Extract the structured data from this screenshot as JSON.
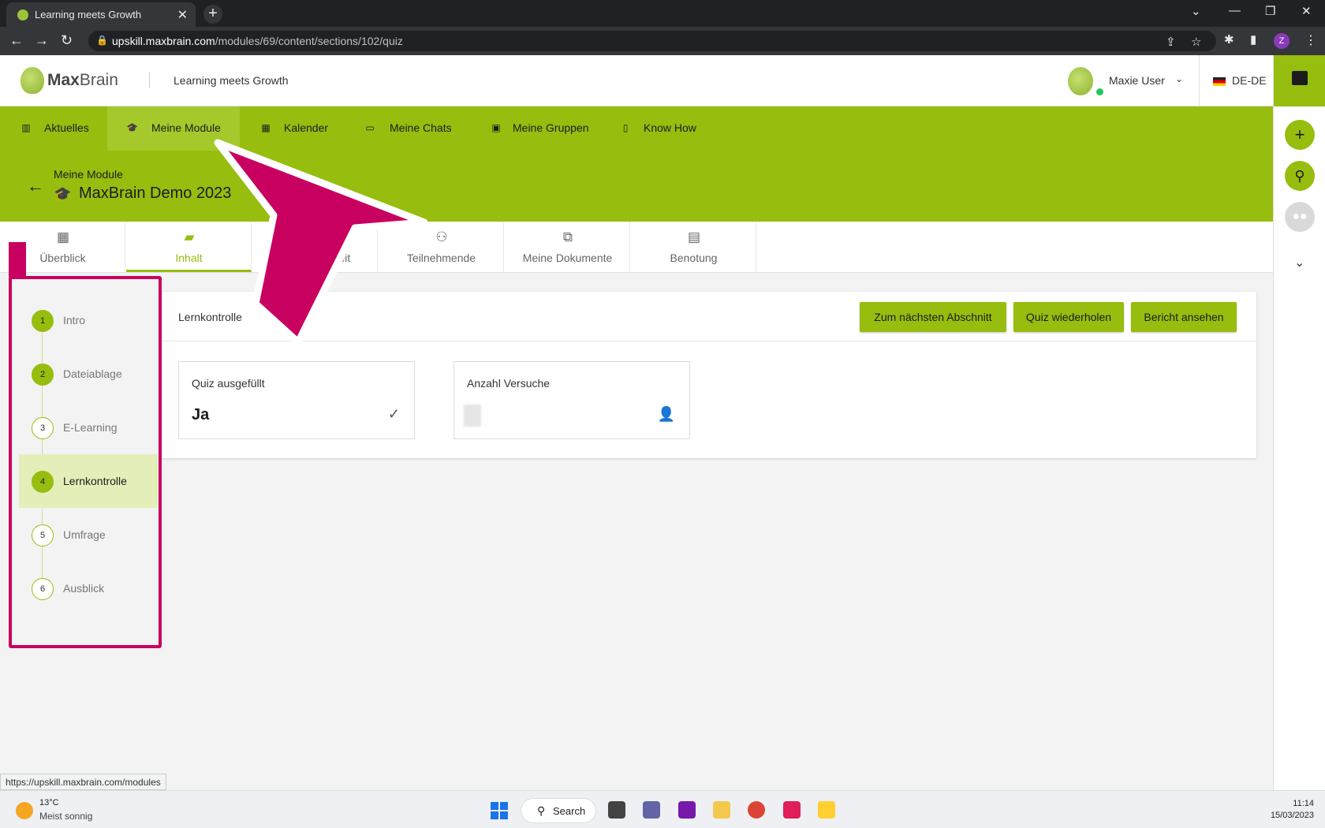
{
  "browser": {
    "tab_title": "Learning meets Growth",
    "new_tab": "+",
    "url_host": "upskill.maxbrain.com",
    "url_path": "/modules/69/content/sections/102/quiz",
    "profile_initial": "Z"
  },
  "header": {
    "logo_max": "Max",
    "logo_brain": "Brain",
    "tagline": "Learning meets Growth",
    "user_name": "Maxie User",
    "language": "DE-DE"
  },
  "nav": {
    "items": [
      {
        "label": "Aktuelles",
        "icon": "newspaper-icon"
      },
      {
        "label": "Meine Module",
        "icon": "graduation-cap-icon"
      },
      {
        "label": "Kalender",
        "icon": "calendar-icon"
      },
      {
        "label": "Meine Chats",
        "icon": "chat-icon"
      },
      {
        "label": "Meine Gruppen",
        "icon": "groups-icon"
      },
      {
        "label": "Know How",
        "icon": "book-icon"
      }
    ]
  },
  "module": {
    "breadcrumb": "Meine Module",
    "title": "MaxBrain Demo 2023"
  },
  "tabs": [
    {
      "label": "Überblick",
      "icon": "dashboard-icon"
    },
    {
      "label": "Inhalt",
      "icon": "folder-icon"
    },
    {
      "label": "Gruppenarbeit",
      "icon": "group-work-icon"
    },
    {
      "label": "Teilnehmende",
      "icon": "people-icon"
    },
    {
      "label": "Meine Dokumente",
      "icon": "documents-icon"
    },
    {
      "label": "Benotung",
      "icon": "grade-icon"
    }
  ],
  "steps": [
    {
      "num": "1",
      "label": "Intro",
      "done": true
    },
    {
      "num": "2",
      "label": "Dateiablage",
      "done": true
    },
    {
      "num": "3",
      "label": "E-Learning",
      "done": false
    },
    {
      "num": "4",
      "label": "Lernkontrolle",
      "done": true,
      "active": true
    },
    {
      "num": "5",
      "label": "Umfrage",
      "done": false
    },
    {
      "num": "6",
      "label": "Ausblick",
      "done": false
    }
  ],
  "content": {
    "section_title": "Lernkontrolle",
    "btn_next": "Zum nächsten Abschnitt",
    "btn_repeat": "Quiz wiederholen",
    "btn_report": "Bericht ansehen",
    "stat1_label": "Quiz ausgefüllt",
    "stat1_value": "Ja",
    "stat2_label": "Anzahl Versuche"
  },
  "status_url": "https://upskill.maxbrain.com/modules",
  "taskbar": {
    "temperature": "13°C",
    "weather": "Meist sonnig",
    "search": "Search",
    "time": "11:14",
    "date": "15/03/2023"
  },
  "colors": {
    "brand_green": "#97bd0e",
    "annotation_magenta": "#c8005f"
  }
}
